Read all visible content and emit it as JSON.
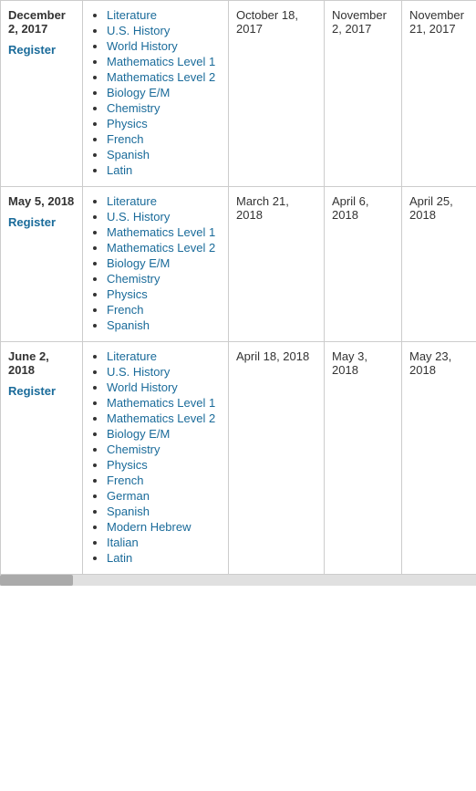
{
  "rows": [
    {
      "date": "December 2, 2017",
      "register_label": "Register",
      "subjects": [
        "Literature",
        "U.S. History",
        "World History",
        "Mathematics Level 1",
        "Mathematics Level 2",
        "Biology E/M",
        "Chemistry",
        "Physics",
        "French",
        "Spanish",
        "Latin"
      ],
      "registration_deadline": "October 18, 2017",
      "score_date1": "November 2, 2017",
      "score_date2": "November 21, 2017"
    },
    {
      "date": "May 5, 2018",
      "register_label": "Register",
      "subjects": [
        "Literature",
        "U.S. History",
        "Mathematics Level 1",
        "Mathematics Level 2",
        "Biology E/M",
        "Chemistry",
        "Physics",
        "French",
        "Spanish"
      ],
      "registration_deadline": "March 21, 2018",
      "score_date1": "April 6, 2018",
      "score_date2": "April 25, 2018"
    },
    {
      "date": "June 2, 2018",
      "register_label": "Register",
      "subjects": [
        "Literature",
        "U.S. History",
        "World History",
        "Mathematics Level 1",
        "Mathematics Level 2",
        "Biology E/M",
        "Chemistry",
        "Physics",
        "French",
        "German",
        "Spanish",
        "Modern Hebrew",
        "Italian",
        "Latin"
      ],
      "registration_deadline": "April 18, 2018",
      "score_date1": "May 3, 2018",
      "score_date2": "May 23, 2018"
    }
  ]
}
